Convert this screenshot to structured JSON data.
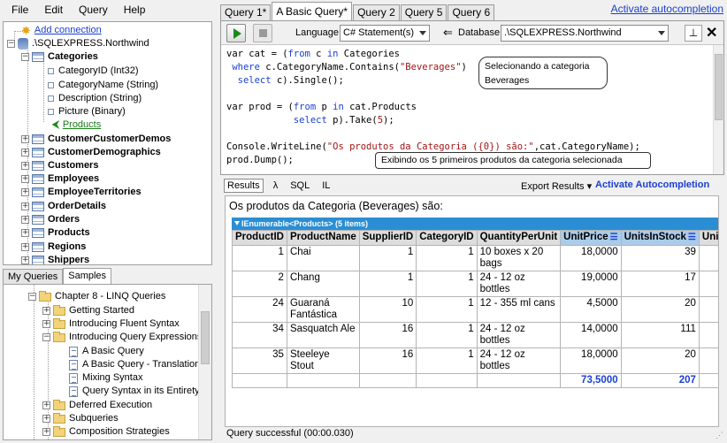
{
  "menu": {
    "file": "File",
    "edit": "Edit",
    "query": "Query",
    "help": "Help"
  },
  "activate_link": "Activate autocompletion",
  "connection": {
    "add": "Add connection",
    "server": ".\\SQLEXPRESS.Northwind",
    "categories": "Categories",
    "columns": [
      "CategoryID (Int32)",
      "CategoryName (String)",
      "Description (String)",
      "Picture (Binary)"
    ],
    "products_link": "Products",
    "tables": [
      "CustomerCustomerDemos",
      "CustomerDemographics",
      "Customers",
      "Employees",
      "EmployeeTerritories",
      "OrderDetails",
      "Orders",
      "Products",
      "Regions",
      "Shippers"
    ]
  },
  "left_tabs": {
    "my_queries": "My Queries",
    "samples": "Samples"
  },
  "samples": {
    "chapter": "Chapter 8 - LINQ Queries",
    "items": [
      "Getting Started",
      "Introducing Fluent Syntax",
      "Introducing Query Expressions"
    ],
    "children": [
      "A Basic Query",
      "A Basic Query - Translation",
      "Mixing Syntax",
      "Query Syntax in its Entirety"
    ],
    "after": [
      "Deferred Execution",
      "Subqueries",
      "Composition Strategies"
    ]
  },
  "query_tabs": [
    "Query 1*",
    "A Basic Query*",
    "Query 2",
    "Query 5",
    "Query 6"
  ],
  "toolbar": {
    "language_label": "Language",
    "language": "C# Statement(s)",
    "db_label": "Database",
    "database": ".\\SQLEXPRESS.Northwind",
    "db_arrow": "⇐"
  },
  "code": {
    "l1a": "var cat = (",
    "l1b": "from",
    "l1c": " c ",
    "l1d": "in",
    "l1e": " Categories",
    "l2a": " where",
    "l2b": " c.CategoryName.Contains(",
    "l2c": "\"Beverages\"",
    "l2d": ")",
    "l3a": " select",
    "l3b": " c).Single();",
    "l5a": "var prod = (",
    "l5b": "from",
    "l5c": " p ",
    "l5d": "in",
    "l5e": " cat.Products",
    "l6a": "select",
    "l6b": " p).Take(",
    "l6c": "5",
    "l6d": ");",
    "l8a": "Console.WriteLine(",
    "l8b": "\"Os produtos da Categoria ({0}) são:\"",
    "l8c": ",cat.CategoryName);",
    "l9": "prod.Dump();"
  },
  "callouts": {
    "c1a": "Selecionando a categoria",
    "c1b": "Beverages",
    "c2": "Exibindo os 5 primeiros produtos da categoria selecionada"
  },
  "result_tabs": {
    "results": "Results",
    "lambda": "λ",
    "sql": "SQL",
    "il": "IL"
  },
  "export": "Export Results",
  "activate_btn": "Activate Autocompletion",
  "result_title": "Os produtos da Categoria (Beverages) são:",
  "grid_title": "IEnumerable<Products> (5 items)",
  "columns": [
    "ProductID",
    "ProductName",
    "SupplierID",
    "CategoryID",
    "QuantityPerUnit",
    "UnitPrice",
    "UnitsInStock",
    "UnitsOn"
  ],
  "rows": [
    [
      "1",
      "Chai",
      "1",
      "1",
      "10 boxes x 20 bags",
      "18,0000",
      "39"
    ],
    [
      "2",
      "Chang",
      "1",
      "1",
      "24 - 12 oz bottles",
      "19,0000",
      "17"
    ],
    [
      "24",
      "Guaraná Fantástica",
      "10",
      "1",
      "12 - 355 ml cans",
      "4,5000",
      "20"
    ],
    [
      "34",
      "Sasquatch Ale",
      "16",
      "1",
      "24 - 12 oz bottles",
      "14,0000",
      "111"
    ],
    [
      "35",
      "Steeleye Stout",
      "16",
      "1",
      "24 - 12 oz bottles",
      "18,0000",
      "20"
    ]
  ],
  "totals": {
    "unitprice": "73,5000",
    "unitsinstock": "207"
  },
  "status": "Query successful  (00:00.030)"
}
